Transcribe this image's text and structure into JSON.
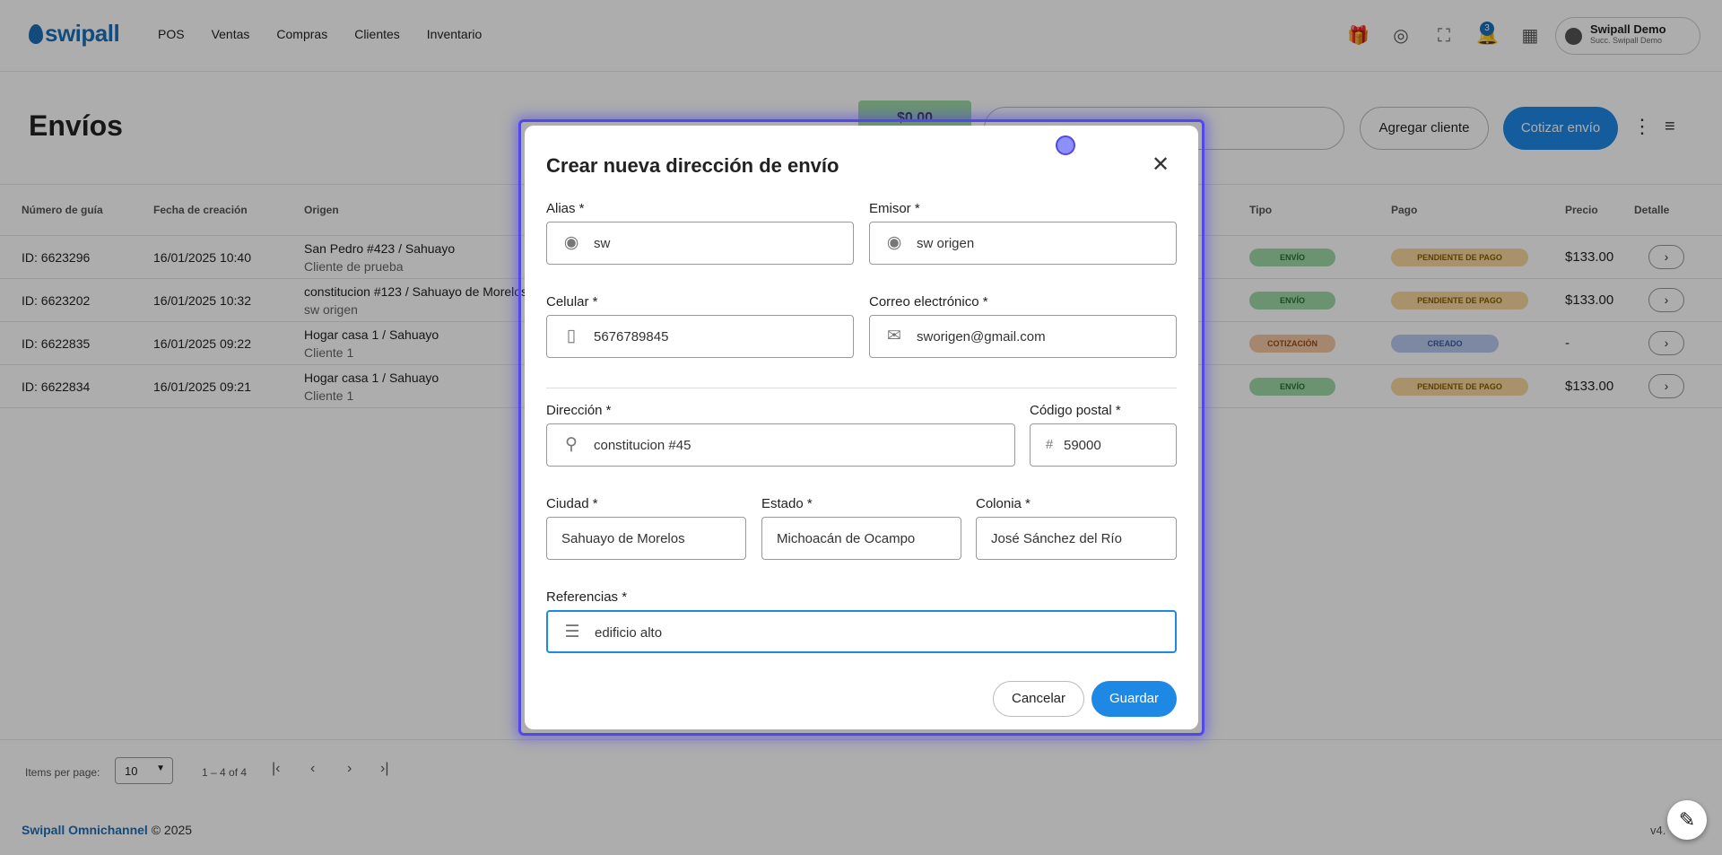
{
  "header": {
    "logo_text": "swipall",
    "nav": [
      "POS",
      "Ventas",
      "Compras",
      "Clientes",
      "Inventario"
    ],
    "notifications_count": "3",
    "user_name": "Swipall Demo",
    "user_branch": "Succ. Swipall Demo",
    "icons": [
      "gift-icon",
      "support-icon",
      "fullscreen-icon",
      "bell-icon",
      "apps-icon"
    ]
  },
  "page": {
    "title": "Envíos",
    "total": "$0.00",
    "add_client_label": "Agregar cliente",
    "quote_label": "Cotizar envío"
  },
  "table": {
    "columns": [
      "Número de guía",
      "Fecha de creación",
      "Origen",
      "Tipo",
      "Pago",
      "Precio",
      "Detalle"
    ],
    "rows": [
      {
        "id": "ID: 6623296",
        "date": "16/01/2025 10:40",
        "origin": "San Pedro #423 / Sahuayo",
        "client": "Cliente de prueba",
        "type": "ENVÍO",
        "payment": "PENDIENTE DE PAGO",
        "price": "$133.00"
      },
      {
        "id": "ID: 6623202",
        "date": "16/01/2025 10:32",
        "origin": "constitucion #123 / Sahuayo de Morelos",
        "client": "sw origen",
        "type": "ENVÍO",
        "payment": "PENDIENTE DE PAGO",
        "price": "$133.00"
      },
      {
        "id": "ID: 6622835",
        "date": "16/01/2025 09:22",
        "origin": "Hogar casa 1 / Sahuayo",
        "client": "Cliente 1",
        "type": "COTIZACIÓN",
        "payment": "CREADO",
        "price": "-"
      },
      {
        "id": "ID: 6622834",
        "date": "16/01/2025 09:21",
        "origin": "Hogar casa 1 / Sahuayo",
        "client": "Cliente 1",
        "type": "ENVÍO",
        "payment": "PENDIENTE DE PAGO",
        "price": "$133.00"
      }
    ]
  },
  "paginator": {
    "items_per_page_label": "Items per page:",
    "items_per_page": "10",
    "range": "1 – 4 of 4"
  },
  "footer": {
    "brand": "Swipall Omnichannel",
    "year": "© 2025",
    "version": "v4."
  },
  "modal": {
    "title": "Crear nueva dirección de envío",
    "fields": {
      "alias": {
        "label": "Alias *",
        "value": "sw"
      },
      "sender": {
        "label": "Emisor *",
        "value": "sw origen"
      },
      "phone": {
        "label": "Celular *",
        "value": "5676789845"
      },
      "email": {
        "label": "Correo electrónico *",
        "value": "sworigen@gmail.com"
      },
      "address": {
        "label": "Dirección *",
        "value": "constitucion #45"
      },
      "zip": {
        "label": "Código postal *",
        "value": "59000"
      },
      "city": {
        "label": "Ciudad *",
        "value": "Sahuayo de Morelos"
      },
      "state": {
        "label": "Estado *",
        "value": "Michoacán de Ocampo"
      },
      "colony": {
        "label": "Colonia *",
        "value": "José Sánchez del Río"
      },
      "references": {
        "label": "Referencias *",
        "value": "edificio alto"
      }
    },
    "cancel_label": "Cancelar",
    "save_label": "Guardar"
  }
}
